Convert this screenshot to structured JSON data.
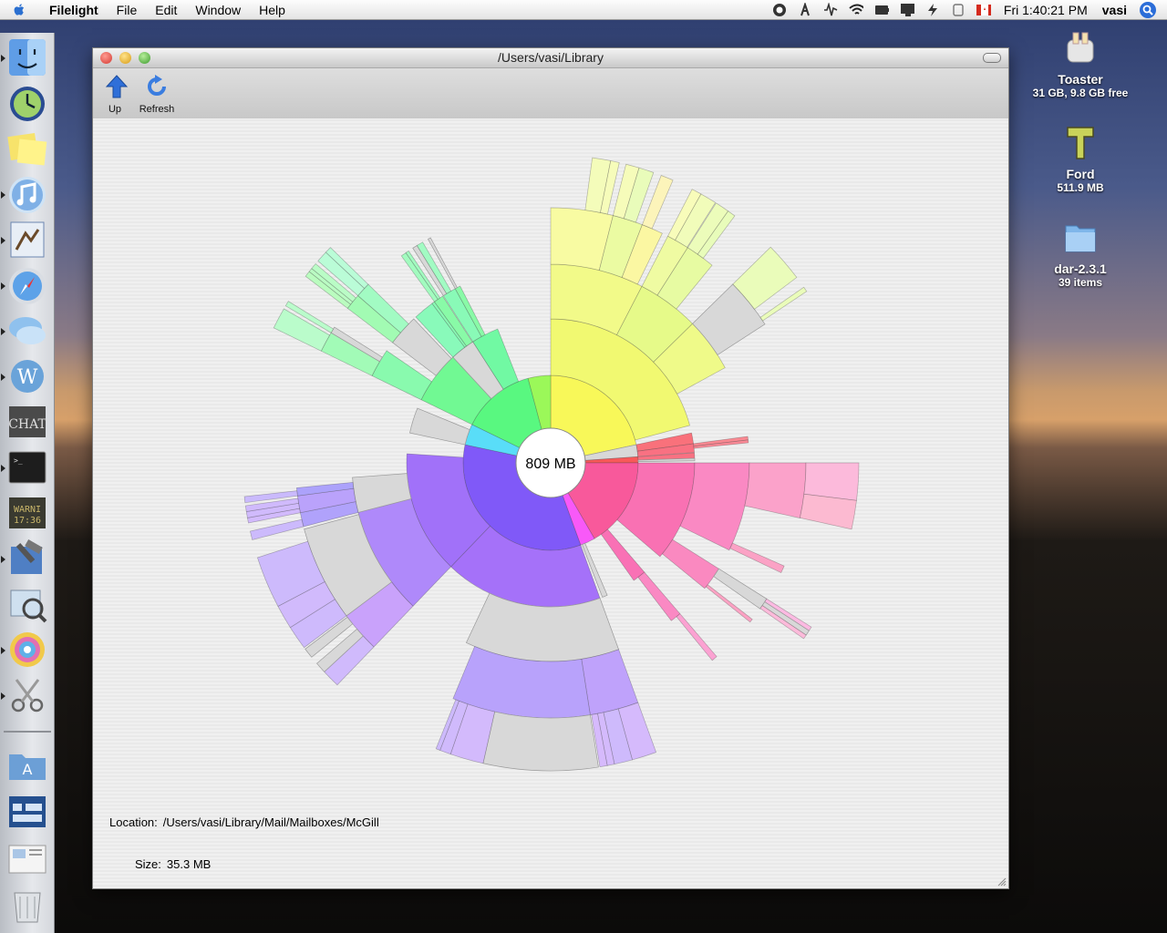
{
  "menubar": {
    "app_name": "Filelight",
    "items": [
      "File",
      "Edit",
      "Window",
      "Help"
    ],
    "clock": "Fri 1:40:21 PM",
    "user": "vasi"
  },
  "window": {
    "title": "/Users/vasi/Library",
    "toolbar": {
      "up_label": "Up",
      "refresh_label": "Refresh"
    },
    "center_label": "809 MB",
    "location_label": "Location:",
    "location_value": "/Users/vasi/Library/Mail/Mailboxes/McGill",
    "size_label": "Size:",
    "size_value": "35.3 MB"
  },
  "desktop": {
    "icons": [
      {
        "name": "Toaster",
        "sub": "31 GB, 9.8 GB free"
      },
      {
        "name": "Ford",
        "sub": "511.9 MB"
      },
      {
        "name": "dar-2.3.1",
        "sub": "39 items"
      }
    ]
  },
  "dock": {
    "items": [
      "finder-icon",
      "time-machine-icon",
      "stickies-icon",
      "itunes-icon",
      "mail-icon",
      "safari-icon",
      "ichat-icon",
      "wordpress-icon",
      "chat-icon",
      "terminal-icon",
      "console-icon",
      "xcode-icon",
      "preview-icon",
      "filelight-icon",
      "scissors-icon",
      "applications-folder-icon",
      "dashboard-icon",
      "documents-icon",
      "trash-icon"
    ]
  },
  "colors": {
    "accent": "#2b6dd8",
    "close": "#e2463f",
    "minimize": "#e8b321",
    "zoom": "#4fb13c"
  }
}
